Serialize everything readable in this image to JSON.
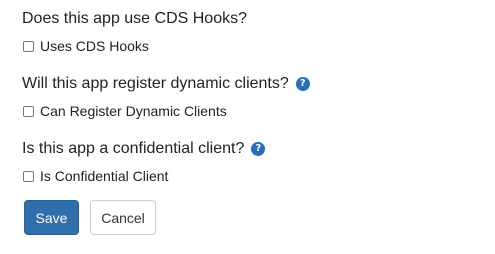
{
  "questions": [
    {
      "text": "Does this app use CDS Hooks?",
      "has_help": false,
      "checkbox_label": "Uses CDS Hooks",
      "checked": false
    },
    {
      "text": "Will this app register dynamic clients?",
      "has_help": true,
      "checkbox_label": "Can Register Dynamic Clients",
      "checked": false
    },
    {
      "text": "Is this app a confidential client?",
      "has_help": true,
      "checkbox_label": "Is Confidential Client",
      "checked": false
    }
  ],
  "icons": {
    "help": "question-circle-icon",
    "help_glyph": "?"
  },
  "actions": {
    "save_label": "Save",
    "cancel_label": "Cancel"
  },
  "colors": {
    "primary": "#2f6fae",
    "help_icon": "#2a6ebb",
    "text": "#222222"
  }
}
